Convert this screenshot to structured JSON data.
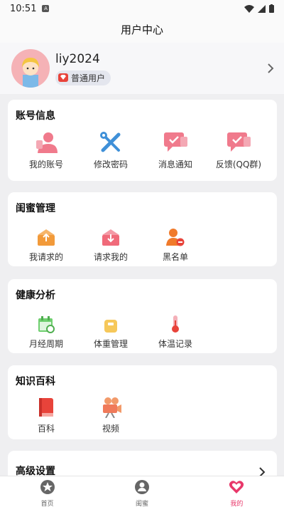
{
  "status_bar": {
    "time": "10:51",
    "badge": "A"
  },
  "header": {
    "title": "用户中心"
  },
  "profile": {
    "username": "liy2024",
    "badge": "普通用户"
  },
  "sections": {
    "account": {
      "title": "账号信息",
      "items": [
        "我的账号",
        "修改密码",
        "消息通知",
        "反馈(QQ群)"
      ]
    },
    "bestie": {
      "title": "闺蜜管理",
      "items": [
        "我请求的",
        "请求我的",
        "黑名单"
      ]
    },
    "health": {
      "title": "健康分析",
      "items": [
        "月经周期",
        "体重管理",
        "体温记录"
      ]
    },
    "knowledge": {
      "title": "知识百科",
      "items": [
        "百科",
        "视频"
      ]
    },
    "advanced": {
      "title": "高级设置"
    }
  },
  "bottom_nav": {
    "tabs": [
      "首页",
      "闺蜜",
      "我的"
    ],
    "active": 2
  },
  "colors": {
    "accent": "#e8386a",
    "pink": "#f07a8c",
    "orange": "#f29a3a",
    "green": "#6fcf6f",
    "blue": "#3f90d8"
  }
}
